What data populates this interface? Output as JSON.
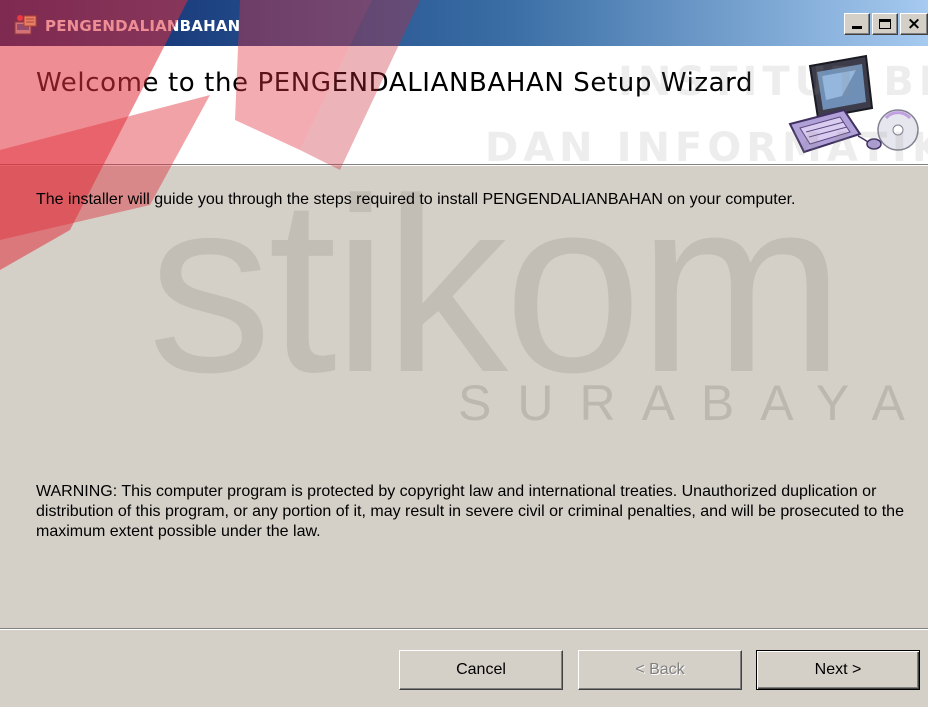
{
  "window": {
    "title": "PENGENDALIANBAHAN",
    "controls": {
      "minimize": "minimize",
      "maximize": "maximize",
      "close": "×"
    }
  },
  "banner": {
    "heading": "Welcome to the PENGENDALIANBAHAN Setup Wizard",
    "icon": "computer-setup-icon"
  },
  "body": {
    "intro": "The installer will guide you through the steps required to install PENGENDALIANBAHAN on your computer.",
    "warning": "WARNING: This computer program is protected by copyright law and international treaties. Unauthorized duplication or distribution of this program, or any portion of it, may result in severe civil or criminal penalties, and will be prosecuted to the maximum extent possible under the law."
  },
  "buttons": {
    "cancel": "Cancel",
    "back": "< Back",
    "next": "Next >"
  },
  "watermark": {
    "logo_word": "stikom",
    "city": "SURABAYA",
    "line1": "INSTITUT BISNIS",
    "line2": "DAN INFORMATIKA"
  },
  "colors": {
    "title_bar_start": "#0a246a",
    "title_bar_end": "#a6caf0",
    "dialog_face": "#d4d0c8",
    "banner_background": "#ffffff",
    "watermark_red": "#e0303c"
  }
}
